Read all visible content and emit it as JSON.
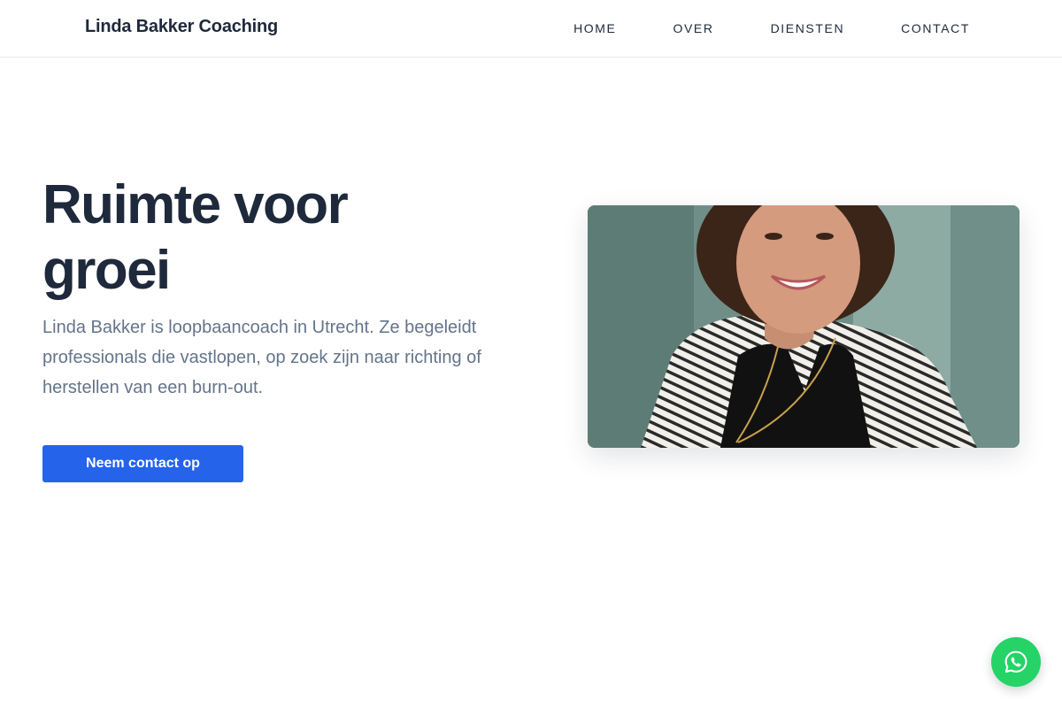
{
  "header": {
    "brand": "Linda Bakker Coaching",
    "nav": [
      "HOME",
      "OVER",
      "DIENSTEN",
      "CONTACT"
    ]
  },
  "hero": {
    "title_line1": "Ruimte voor",
    "title_line2": "groei",
    "text": "Linda Bakker is loopbaancoach in Utrecht. Ze begeleidt professionals die vastlopen, op zoek zijn naar richting of herstellen van een burn-out.",
    "cta_label": "Neem contact op"
  },
  "image": {
    "alt": "Linda Bakker"
  },
  "floating": {
    "icon": "whatsapp-icon"
  },
  "colors": {
    "accent": "#2563eb",
    "heading": "#1e293b",
    "body_text": "#64748b",
    "whatsapp": "#25d366"
  }
}
